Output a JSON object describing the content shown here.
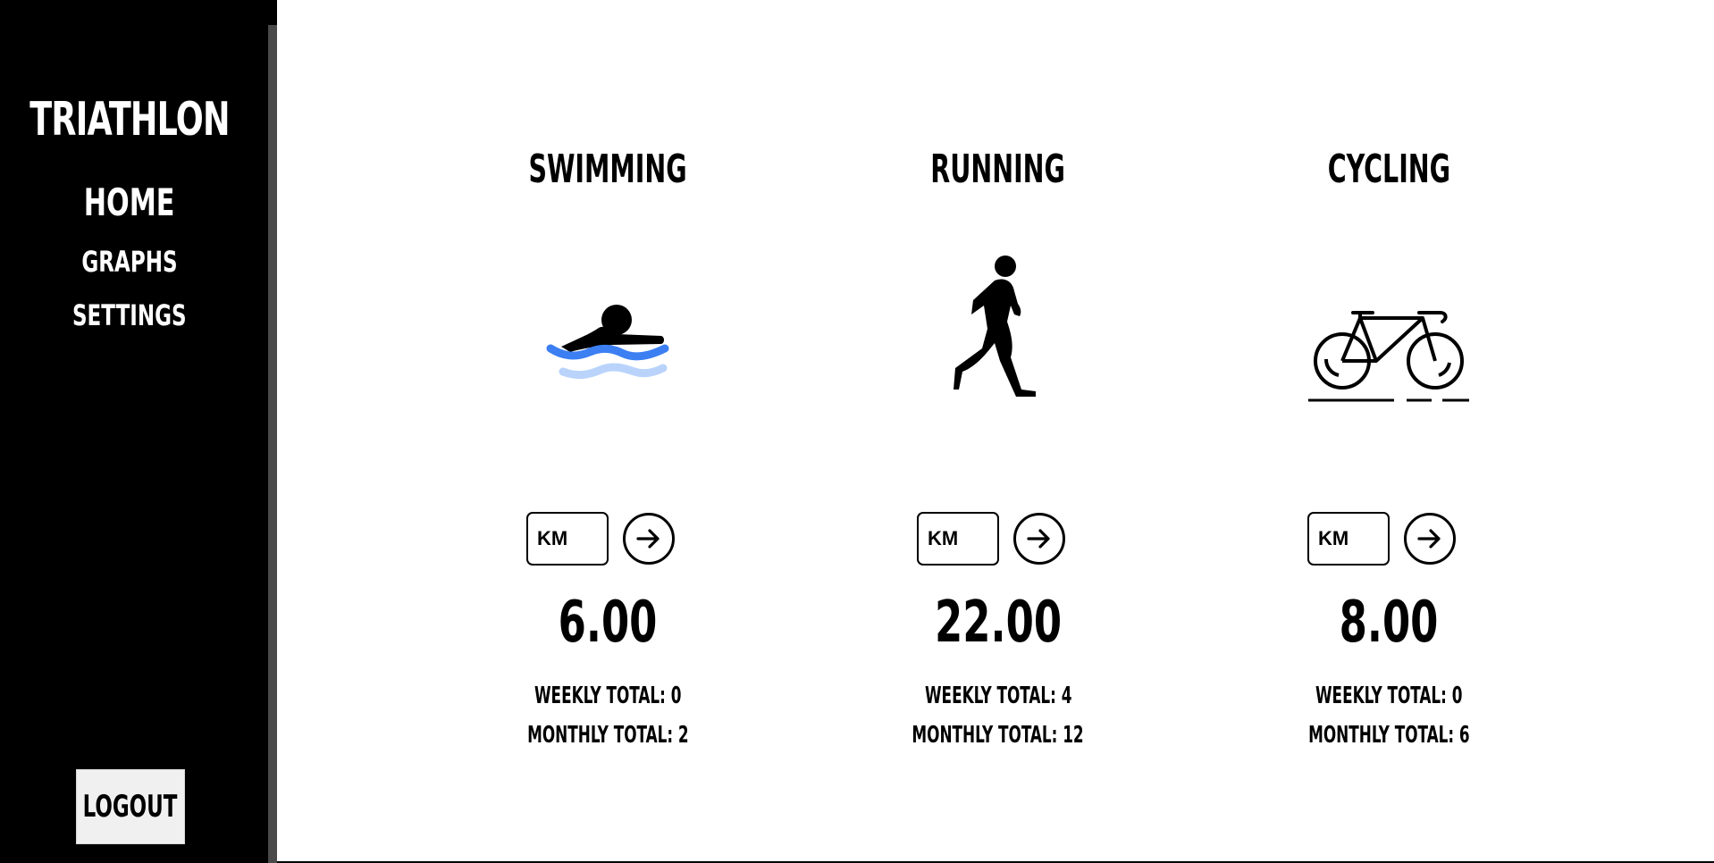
{
  "sidebar": {
    "brand": "TRIATHLON",
    "nav": {
      "home": "HOME",
      "graphs": "GRAPHS",
      "settings": "SETTINGS"
    },
    "logout": "LOGOUT"
  },
  "cards": [
    {
      "title": "SWIMMING",
      "icon": "swimmer-icon",
      "input_placeholder": "KM",
      "value": "6.00",
      "weekly": "WEEKLY TOTAL: 0",
      "monthly": "MONTHLY TOTAL: 2"
    },
    {
      "title": "RUNNING",
      "icon": "runner-icon",
      "input_placeholder": "KM",
      "value": "22.00",
      "weekly": "WEEKLY TOTAL: 4",
      "monthly": "MONTHLY TOTAL: 12"
    },
    {
      "title": "CYCLING",
      "icon": "bicycle-icon",
      "input_placeholder": "KM",
      "value": "8.00",
      "weekly": "WEEKLY TOTAL: 0",
      "monthly": "MONTHLY TOTAL: 6"
    }
  ],
  "colors": {
    "sidebar": "#000000",
    "water_dark": "#3b7ff2",
    "water_light": "#b9d3fb"
  }
}
